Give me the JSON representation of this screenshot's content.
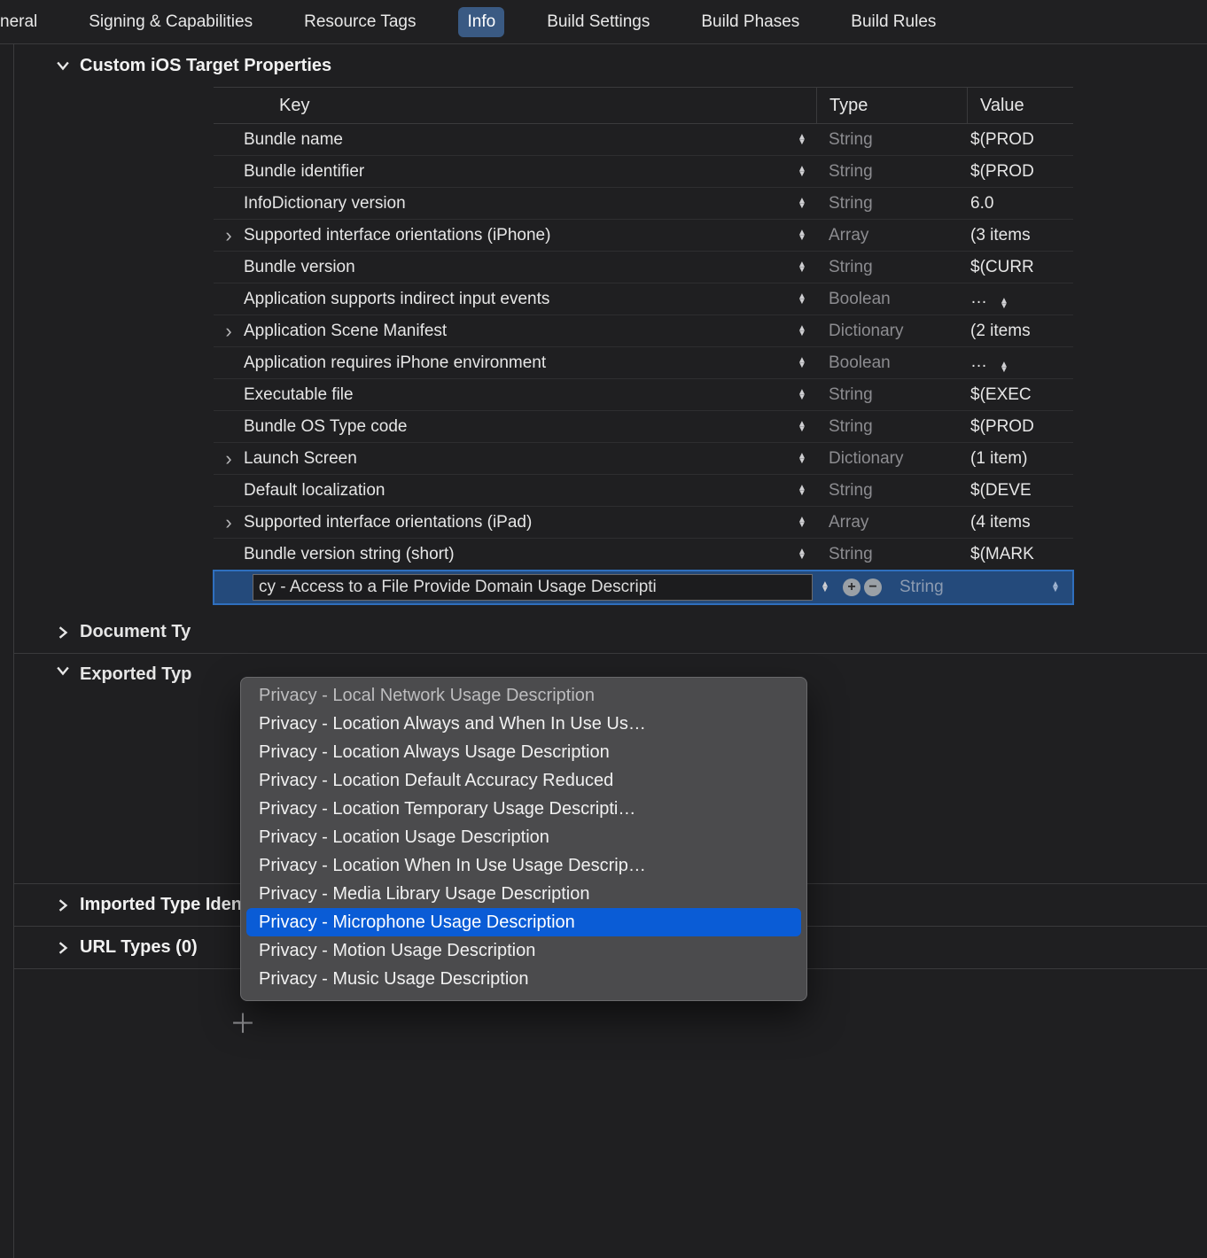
{
  "tabs": {
    "general": "neral",
    "signing": "Signing & Capabilities",
    "resource": "Resource Tags",
    "info": "Info",
    "build_settings": "Build Settings",
    "build_phases": "Build Phases",
    "build_rules": "Build Rules"
  },
  "sections": {
    "custom_props": "Custom iOS Target Properties",
    "doc_types": "Document Ty",
    "exported_types": "Exported Typ",
    "imported_types": "Imported Type Identifiers (0)",
    "url_types": "URL Types (0)"
  },
  "columns": {
    "key": "Key",
    "type": "Type",
    "value": "Value"
  },
  "rows": [
    {
      "exp": false,
      "key": "Bundle name",
      "type": "String",
      "value": "$(PROD"
    },
    {
      "exp": false,
      "key": "Bundle identifier",
      "type": "String",
      "value": "$(PROD"
    },
    {
      "exp": false,
      "key": "InfoDictionary version",
      "type": "String",
      "value": "6.0"
    },
    {
      "exp": true,
      "key": "Supported interface orientations (iPhone)",
      "type": "Array",
      "value": "(3 items"
    },
    {
      "exp": false,
      "key": "Bundle version",
      "type": "String",
      "value": "$(CURR"
    },
    {
      "exp": false,
      "key": "Application supports indirect input events",
      "type": "Boolean",
      "value": "…"
    },
    {
      "exp": true,
      "key": "Application Scene Manifest",
      "type": "Dictionary",
      "value": "(2 items"
    },
    {
      "exp": false,
      "key": "Application requires iPhone environment",
      "type": "Boolean",
      "value": "…"
    },
    {
      "exp": false,
      "key": "Executable file",
      "type": "String",
      "value": "$(EXEC"
    },
    {
      "exp": false,
      "key": "Bundle OS Type code",
      "type": "String",
      "value": "$(PROD"
    },
    {
      "exp": true,
      "key": "Launch Screen",
      "type": "Dictionary",
      "value": "(1 item)"
    },
    {
      "exp": false,
      "key": "Default localization",
      "type": "String",
      "value": "$(DEVE"
    },
    {
      "exp": true,
      "key": "Supported interface orientations (iPad)",
      "type": "Array",
      "value": "(4 items"
    },
    {
      "exp": false,
      "key": "Bundle version string (short)",
      "type": "String",
      "value": "$(MARK"
    }
  ],
  "editing_row": {
    "key_text": "cy - Access to a File Provide Domain Usage Descripti",
    "type": "String"
  },
  "dropdown": {
    "options": [
      "Privacy - Local Network Usage Description",
      "Privacy - Location Always and When In Use Us…",
      "Privacy - Location Always Usage Description",
      "Privacy - Location Default Accuracy Reduced",
      "Privacy - Location Temporary Usage Descripti…",
      "Privacy - Location Usage Description",
      "Privacy - Location When In Use Usage Descrip…",
      "Privacy - Media Library Usage Description",
      "Privacy - Microphone Usage Description",
      "Privacy - Motion Usage Description",
      "Privacy - Music Usage Description"
    ],
    "selected_index": 8
  }
}
